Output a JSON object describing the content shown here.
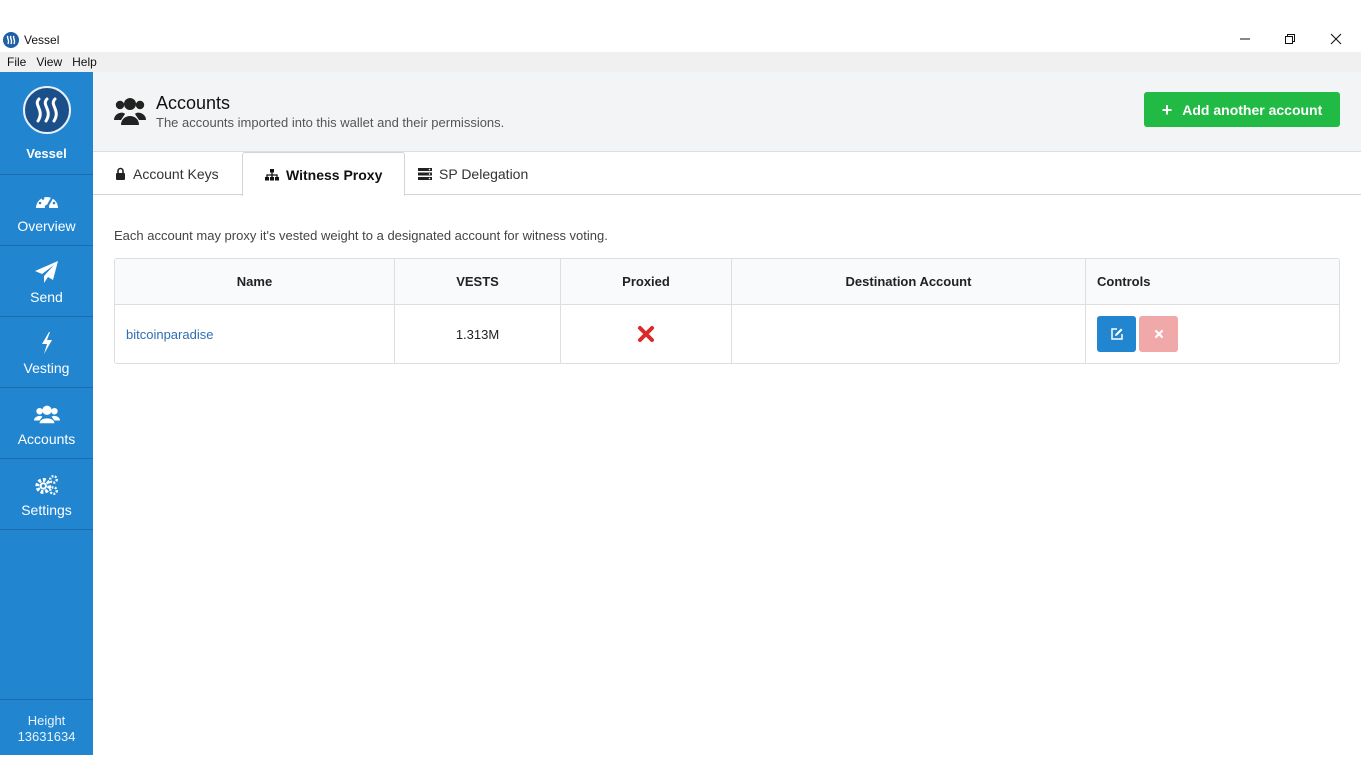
{
  "window": {
    "title": "Vessel"
  },
  "menu": {
    "items": [
      "File",
      "View",
      "Help"
    ]
  },
  "sidebar": {
    "brand_label": "Vessel",
    "items": [
      {
        "label": "Overview",
        "icon": "dashboard-icon"
      },
      {
        "label": "Send",
        "icon": "paper-plane-icon"
      },
      {
        "label": "Vesting",
        "icon": "lightning-icon"
      },
      {
        "label": "Accounts",
        "icon": "users-icon"
      },
      {
        "label": "Settings",
        "icon": "gears-icon"
      }
    ],
    "height_label": "Height",
    "height_value": "13631634"
  },
  "header": {
    "title": "Accounts",
    "subtitle": "The accounts imported into this wallet and their permissions.",
    "add_button": "Add another account"
  },
  "tabs": [
    {
      "label": "Account Keys",
      "icon": "lock-icon",
      "active": false
    },
    {
      "label": "Witness Proxy",
      "icon": "sitemap-icon",
      "active": true
    },
    {
      "label": "SP Delegation",
      "icon": "server-icon",
      "active": false
    }
  ],
  "content": {
    "description": "Each account may proxy it's vested weight to a designated account for witness voting.",
    "table": {
      "headers": [
        "Name",
        "VESTS",
        "Proxied",
        "Destination Account",
        "Controls"
      ],
      "rows": [
        {
          "name": "bitcoinparadise",
          "vests": "1.313M",
          "proxied": false,
          "destination": ""
        }
      ]
    }
  },
  "colors": {
    "sidebar": "#2185d0",
    "add_button": "#21ba45",
    "link": "#2f6eb4",
    "proxied_false": "#db2828",
    "edit_button": "#2185d0",
    "remove_button": "#f0a8a8"
  }
}
